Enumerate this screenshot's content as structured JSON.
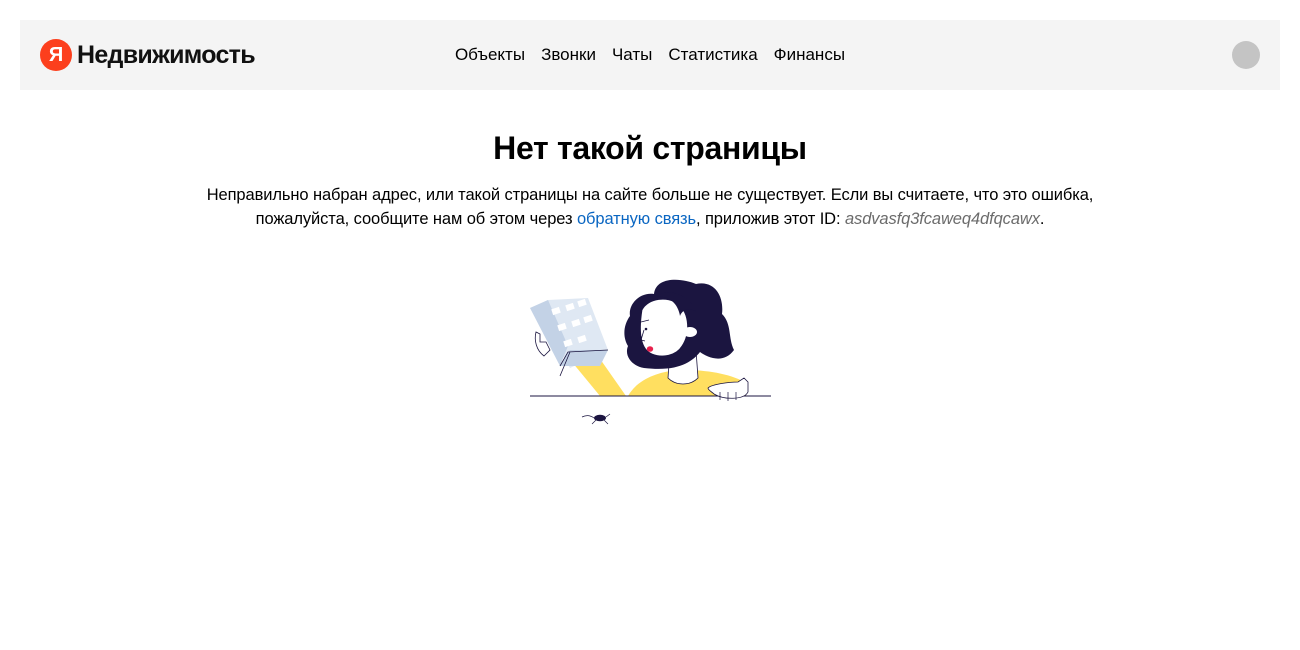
{
  "header": {
    "logo": {
      "mark": "Я",
      "text": "Недвижимость",
      "icon": "yandex-logo-icon",
      "color": "#fc3f1d"
    },
    "nav": [
      {
        "label": "Объекты"
      },
      {
        "label": "Звонки"
      },
      {
        "label": "Чаты"
      },
      {
        "label": "Статистика"
      },
      {
        "label": "Финансы"
      }
    ],
    "avatar": {
      "icon": "user-avatar-icon"
    }
  },
  "main": {
    "title": "Нет такой страницы",
    "description": {
      "part1": "Неправильно набран адрес, или такой страницы на сайте больше не существует. Если вы считаете, что это ошибка, пожалуйста, сообщите нам об этом через ",
      "link": "обратную связь",
      "part2": ", приложив этот ID: ",
      "request_id": "asdvasfq3fcaweq4dfqcawx",
      "part3": "."
    },
    "illustration": "woman-holding-building-illustration"
  },
  "colors": {
    "header_bg": "#f4f4f4",
    "link": "#0a66c2",
    "accent_yellow": "#ffdf60",
    "hair_navy": "#1b1540"
  }
}
